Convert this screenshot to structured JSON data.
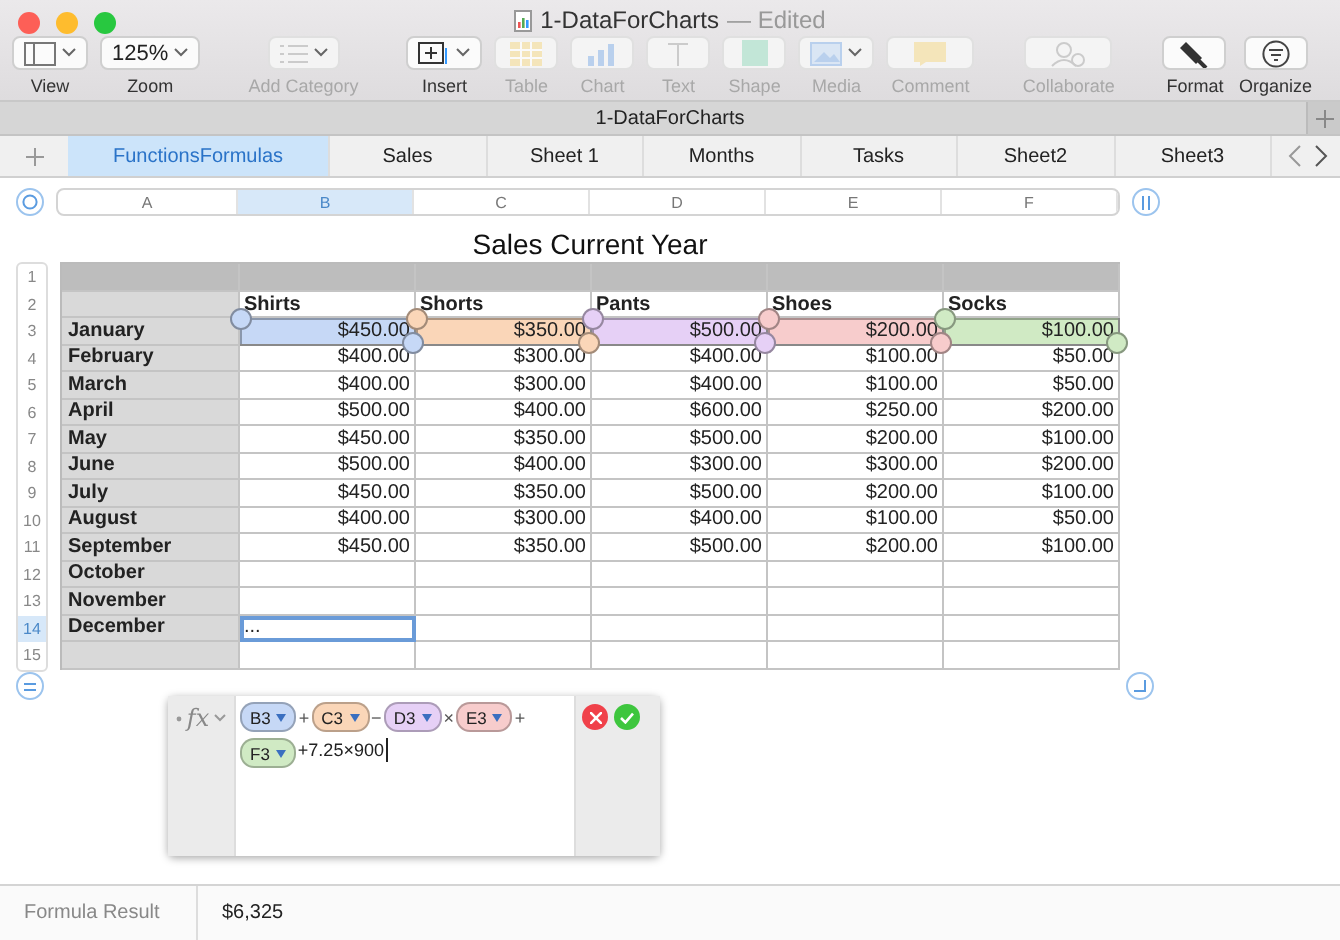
{
  "window": {
    "title": "1-DataForCharts",
    "subtitle": "— Edited"
  },
  "toolbar": [
    {
      "kind": "view",
      "label": "View",
      "disabled": false
    },
    {
      "kind": "zoom",
      "label": "Zoom",
      "value": "125%",
      "disabled": false
    },
    {
      "kind": "category",
      "label": "Add Category",
      "disabled": true
    },
    {
      "kind": "insert",
      "label": "Insert",
      "disabled": false
    },
    {
      "kind": "table",
      "label": "Table",
      "disabled": true
    },
    {
      "kind": "chart",
      "label": "Chart",
      "disabled": true
    },
    {
      "kind": "text",
      "label": "Text",
      "disabled": true
    },
    {
      "kind": "shape",
      "label": "Shape",
      "disabled": true
    },
    {
      "kind": "media",
      "label": "Media",
      "disabled": true
    },
    {
      "kind": "comment",
      "label": "Comment",
      "disabled": true
    },
    {
      "kind": "collaborate",
      "label": "Collaborate",
      "disabled": true
    },
    {
      "kind": "format",
      "label": "Format",
      "disabled": false
    },
    {
      "kind": "organize",
      "label": "Organize",
      "disabled": false
    }
  ],
  "document_title": "1-DataForCharts",
  "sheets": [
    {
      "label": "FunctionsFormulas",
      "selected": true
    },
    {
      "label": "Sales",
      "selected": false
    },
    {
      "label": "Sheet 1",
      "selected": false
    },
    {
      "label": "Months",
      "selected": false
    },
    {
      "label": "Tasks",
      "selected": false
    },
    {
      "label": "Sheet2",
      "selected": false
    },
    {
      "label": "Sheet3",
      "selected": false
    }
  ],
  "table": {
    "title": "Sales Current Year",
    "columns": [
      {
        "label": "A",
        "selected": false
      },
      {
        "label": "B",
        "selected": true
      },
      {
        "label": "C",
        "selected": false
      },
      {
        "label": "D",
        "selected": false
      },
      {
        "label": "E",
        "selected": false
      },
      {
        "label": "F",
        "selected": false
      }
    ],
    "row_numbers": [
      {
        "label": "1",
        "selected": false
      },
      {
        "label": "2",
        "selected": false
      },
      {
        "label": "3",
        "selected": false
      },
      {
        "label": "4",
        "selected": false
      },
      {
        "label": "5",
        "selected": false
      },
      {
        "label": "6",
        "selected": false
      },
      {
        "label": "7",
        "selected": false
      },
      {
        "label": "8",
        "selected": false
      },
      {
        "label": "9",
        "selected": false
      },
      {
        "label": "10",
        "selected": false
      },
      {
        "label": "11",
        "selected": false
      },
      {
        "label": "12",
        "selected": false
      },
      {
        "label": "13",
        "selected": false
      },
      {
        "label": "14",
        "selected": true
      },
      {
        "label": "15",
        "selected": false
      }
    ],
    "headers": [
      "Shirts",
      "Shorts",
      "Pants",
      "Shoes",
      "Socks"
    ],
    "rows": [
      {
        "label": "January",
        "values": [
          "$450.00",
          "$350.00",
          "$500.00",
          "$200.00",
          "$100.00"
        ]
      },
      {
        "label": "February",
        "values": [
          "$400.00",
          "$300.00",
          "$400.00",
          "$100.00",
          "$50.00"
        ]
      },
      {
        "label": "March",
        "values": [
          "$400.00",
          "$300.00",
          "$400.00",
          "$100.00",
          "$50.00"
        ]
      },
      {
        "label": "April",
        "values": [
          "$500.00",
          "$400.00",
          "$600.00",
          "$250.00",
          "$200.00"
        ]
      },
      {
        "label": "May",
        "values": [
          "$450.00",
          "$350.00",
          "$500.00",
          "$200.00",
          "$100.00"
        ]
      },
      {
        "label": "June",
        "values": [
          "$500.00",
          "$400.00",
          "$300.00",
          "$300.00",
          "$200.00"
        ]
      },
      {
        "label": "July",
        "values": [
          "$450.00",
          "$350.00",
          "$500.00",
          "$200.00",
          "$100.00"
        ]
      },
      {
        "label": "August",
        "values": [
          "$400.00",
          "$300.00",
          "$400.00",
          "$100.00",
          "$50.00"
        ]
      },
      {
        "label": "September",
        "values": [
          "$450.00",
          "$350.00",
          "$500.00",
          "$200.00",
          "$100.00"
        ]
      },
      {
        "label": "October"
      },
      {
        "label": "November"
      },
      {
        "label": "December",
        "values": [
          "..."
        ]
      }
    ]
  },
  "formula": {
    "function_label": "fx",
    "tokens": [
      {
        "kind": "ref",
        "text": "B3",
        "color": "#c6d8f6"
      },
      {
        "kind": "op",
        "text": "+"
      },
      {
        "kind": "ref",
        "text": "C3",
        "color": "#fad6b8"
      },
      {
        "kind": "op",
        "text": "−"
      },
      {
        "kind": "ref",
        "text": "D3",
        "color": "#e6d0f6"
      },
      {
        "kind": "op",
        "text": "×"
      },
      {
        "kind": "ref",
        "text": "E3",
        "color": "#f7cccc"
      },
      {
        "kind": "op",
        "text": "+"
      },
      {
        "kind": "ref",
        "text": "F3",
        "color": "#d0eac4"
      },
      {
        "kind": "text",
        "text": "+7.25×900"
      }
    ]
  },
  "status_bar": {
    "label": "Formula Result",
    "value": "$6,325"
  }
}
